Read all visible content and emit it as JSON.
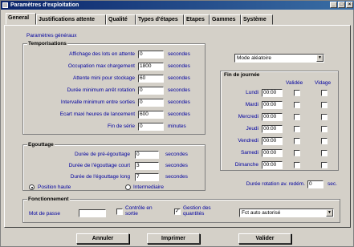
{
  "window": {
    "title": "Paramètres d'exploitation",
    "minimize": "_",
    "maximize": "□",
    "close": "×"
  },
  "tabs": [
    {
      "label": "General"
    },
    {
      "label": "Justifications attente"
    },
    {
      "label": "Qualité"
    },
    {
      "label": "Types d'étapes"
    },
    {
      "label": "Etapes"
    },
    {
      "label": "Gammes"
    },
    {
      "label": "Système"
    }
  ],
  "panel": {
    "title": "Paramètres généraux"
  },
  "temporisations": {
    "title": "Temporisations",
    "rows": [
      {
        "label": "Affichage des lots en attente",
        "value": "0",
        "unit": "secondes"
      },
      {
        "label": "Occupation max chargement",
        "value": "1800",
        "unit": "secondes"
      },
      {
        "label": "Attente mini pour stockage",
        "value": "60",
        "unit": "secondes"
      },
      {
        "label": "Durée minimum arrêt rotation",
        "value": "0",
        "unit": "secondes"
      },
      {
        "label": "Intervalle minimum entre sorties",
        "value": "0",
        "unit": "secondes"
      },
      {
        "label": "Ecart maxi heures de lancement",
        "value": "600",
        "unit": "secondes"
      },
      {
        "label": "Fin de série",
        "value": "0",
        "unit": "minutes"
      }
    ]
  },
  "egouttage": {
    "title": "Egouttage",
    "rows": [
      {
        "label": "Durée de pré-égouttage",
        "value": "0",
        "unit": "secondes"
      },
      {
        "label": "Durée de l'égouttage court",
        "value": "3",
        "unit": "secondes"
      },
      {
        "label": "Durée de l'égouttage long",
        "value": "7",
        "unit": "secondes"
      }
    ],
    "radio_high": "Position haute",
    "radio_mid": "Intermediaire"
  },
  "mode": {
    "selected": "Mode aléatoire"
  },
  "fin_journee": {
    "title": "Fin de journée",
    "col_validee": "Validée",
    "col_vidage": "Vidage",
    "days": [
      {
        "day": "Lundi",
        "time": "00:00"
      },
      {
        "day": "Mardi",
        "time": "00:00"
      },
      {
        "day": "Mercredi",
        "time": "00:00"
      },
      {
        "day": "Jeudi",
        "time": "00:00"
      },
      {
        "day": "Vendredi",
        "time": "00:00"
      },
      {
        "day": "Samedi",
        "time": "00:00"
      },
      {
        "day": "Dimanche",
        "time": "00:00"
      }
    ]
  },
  "rotation": {
    "label": "Durée rotation av. redém.",
    "value": "0",
    "unit": "sec."
  },
  "fonctionnement": {
    "title": "Fonctionnement",
    "password_label": "Mot de passe",
    "password_value": "",
    "controle_label": "Contrôle en sortie",
    "gestion_label": "Gestion des quantités",
    "fct_selected": "Fct auto autorisé"
  },
  "buttons": {
    "cancel": "Annuler",
    "print": "Imprimer",
    "validate": "Valider"
  }
}
